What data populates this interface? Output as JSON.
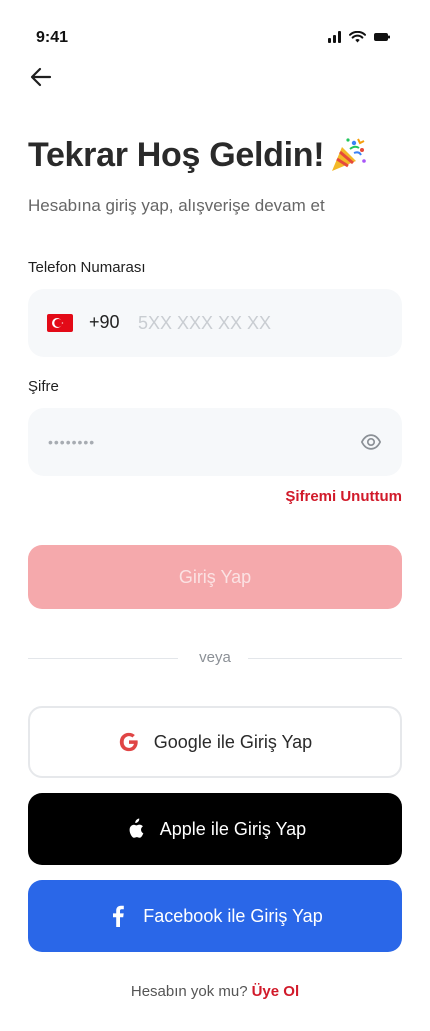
{
  "status_bar": {
    "time": "9:41"
  },
  "header": {
    "title": "Tekrar Hoş Geldin!",
    "subtitle": "Hesabına giriş yap, alışverişe devam et"
  },
  "phone": {
    "label": "Telefon Numarası",
    "country_code": "+90",
    "placeholder": "5XX XXX XX XX",
    "value": ""
  },
  "password": {
    "label": "Şifre",
    "value": "••••••••"
  },
  "forgot_password": "Şifremi Unuttum",
  "login_button": "Giriş Yap",
  "divider": "veya",
  "social": {
    "google": "Google ile Giriş Yap",
    "apple": "Apple ile Giriş Yap",
    "facebook": "Facebook ile Giriş Yap"
  },
  "signup": {
    "prompt": "Hesabın yok mu?",
    "link": "Üye Ol"
  },
  "colors": {
    "brand_red": "#d11a2a",
    "disabled_button": "#f5a9ac",
    "facebook_blue": "#2a67e8",
    "apple_black": "#000000",
    "field_bg": "#f6f8fa"
  },
  "icons": [
    "back-arrow-icon",
    "party-popper-icon",
    "turkey-flag-icon",
    "eye-icon",
    "google-icon",
    "apple-icon",
    "facebook-icon",
    "signal-icon",
    "wifi-icon",
    "battery-icon"
  ]
}
